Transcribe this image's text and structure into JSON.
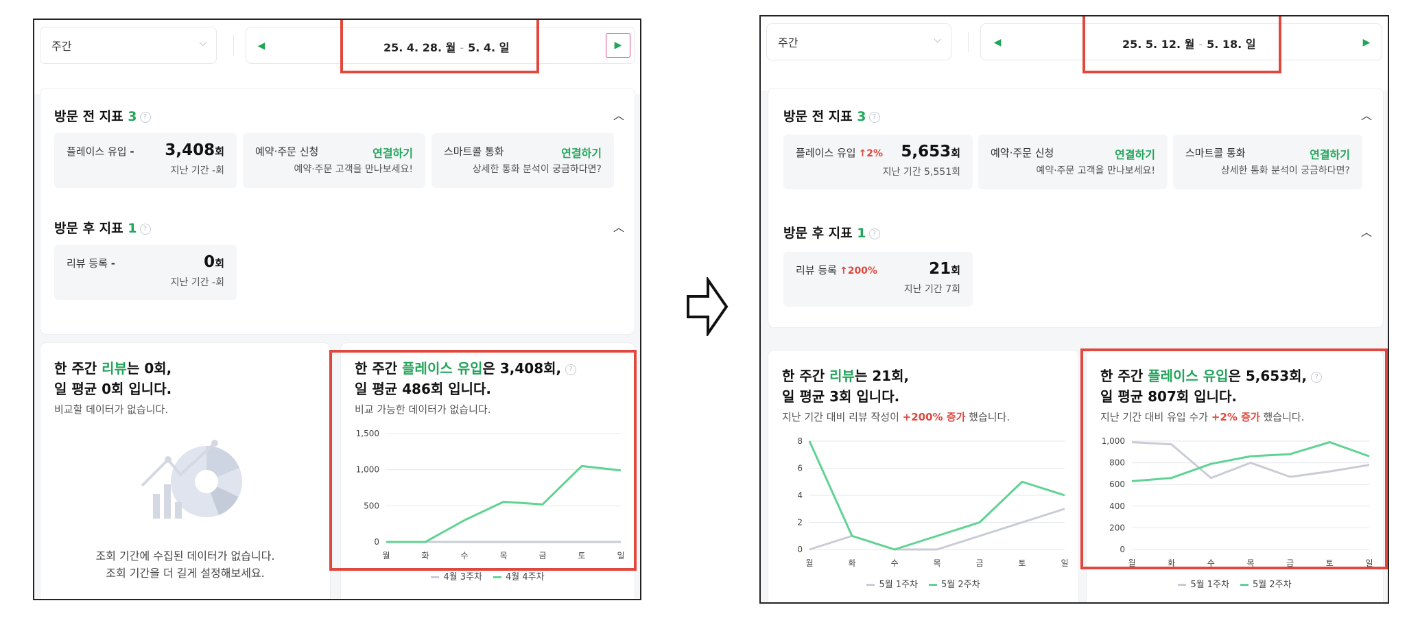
{
  "colors": {
    "accent": "#22a55a",
    "highlight": "#e0483e",
    "prev_line": "#c9ccd6",
    "curr_line": "#5fd392"
  },
  "left": {
    "period": "주간",
    "date_start": "25. 4. 28. 월",
    "date_sep": "-",
    "date_end": "5. 4. 일",
    "pre_visit": {
      "title": "방문 전 지표",
      "count": "3",
      "inflow_label": "플레이스 유입",
      "inflow_trend": "-",
      "inflow_value": "3,408",
      "inflow_unit": "회",
      "inflow_sub": "지난 기간 -회",
      "reserve_label": "예약·주문 신청",
      "reserve_link": "연결하기",
      "reserve_desc": "예약·주문 고객을 만나보세요!",
      "call_label": "스마트콜 통화",
      "call_link": "연결하기",
      "call_desc": "상세한 통화 분석이 궁금하다면?"
    },
    "post_visit": {
      "title": "방문 후 지표",
      "count": "1",
      "review_label": "리뷰 등록",
      "review_trend": "-",
      "review_value": "0",
      "review_unit": "회",
      "review_sub": "지난 기간 -회"
    },
    "review_card": {
      "l1a": "한 주간 ",
      "l1g": "리뷰",
      "l1b": "는 0회,",
      "l2": "일 평균 0회 입니다.",
      "note": "비교할 데이터가 없습니다.",
      "empty1": "조회 기간에 수집된 데이터가 없습니다.",
      "empty2": "조회 기간을 더 길게 설정해보세요."
    },
    "inflow_card": {
      "l1a": "한 주간 ",
      "l1g": "플레이스 유입",
      "l1b": "은 3,408회,",
      "l2": "일 평균 486회 입니다.",
      "note": "비교 가능한 데이터가 없습니다."
    }
  },
  "right": {
    "period": "주간",
    "date_start": "25. 5. 12. 월",
    "date_sep": "-",
    "date_end": "5. 18. 일",
    "pre_visit": {
      "title": "방문 전 지표",
      "count": "3",
      "inflow_label": "플레이스 유입",
      "inflow_trend": "↑2%",
      "inflow_value": "5,653",
      "inflow_unit": "회",
      "inflow_sub": "지난 기간 5,551회",
      "reserve_label": "예약·주문 신청",
      "reserve_link": "연결하기",
      "reserve_desc": "예약·주문 고객을 만나보세요!",
      "call_label": "스마트콜 통화",
      "call_link": "연결하기",
      "call_desc": "상세한 통화 분석이 궁금하다면?"
    },
    "post_visit": {
      "title": "방문 후 지표",
      "count": "1",
      "review_label": "리뷰 등록",
      "review_trend": "↑200%",
      "review_value": "21",
      "review_unit": "회",
      "review_sub": "지난 기간 7회"
    },
    "review_card": {
      "l1a": "한 주간 ",
      "l1g": "리뷰",
      "l1b": "는 21회,",
      "l2": "일 평균 3회 입니다.",
      "note_a": "지난 기간 대비 리뷰 작성이 ",
      "note_r": "+200% 증가",
      "note_b": " 했습니다."
    },
    "inflow_card": {
      "l1a": "한 주간 ",
      "l1g": "플레이스 유입",
      "l1b": "은 5,653회,",
      "l2": "일 평균 807회 입니다.",
      "note_a": "지난 기간 대비 유입 수가 ",
      "note_r": "+2% 증가",
      "note_b": " 했습니다."
    }
  },
  "chart_data": [
    {
      "type": "line",
      "categories": [
        "월",
        "화",
        "수",
        "목",
        "금",
        "토",
        "일"
      ],
      "yticks": [
        "0",
        "500",
        "1,000",
        "1,500"
      ],
      "ylim": [
        0,
        1500
      ],
      "series": [
        {
          "name": "4월 3주차",
          "values": [
            0,
            0,
            0,
            0,
            0,
            0,
            0
          ]
        },
        {
          "name": "4월 4주차",
          "values": [
            0,
            0,
            300,
            555,
            520,
            1050,
            990
          ]
        }
      ]
    },
    {
      "type": "line",
      "categories": [
        "월",
        "화",
        "수",
        "목",
        "금",
        "토",
        "일"
      ],
      "yticks": [
        "0",
        "2",
        "4",
        "6",
        "8"
      ],
      "ylim": [
        0,
        8
      ],
      "series": [
        {
          "name": "5월 1주차",
          "values": [
            0,
            1,
            0,
            0,
            1,
            2,
            3
          ]
        },
        {
          "name": "5월 2주차",
          "values": [
            8,
            1,
            0,
            1,
            2,
            5,
            4
          ]
        }
      ]
    },
    {
      "type": "line",
      "categories": [
        "월",
        "화",
        "수",
        "목",
        "금",
        "토",
        "일"
      ],
      "yticks": [
        "0",
        "200",
        "400",
        "600",
        "800",
        "1,000"
      ],
      "ylim": [
        0,
        1000
      ],
      "series": [
        {
          "name": "5월 1주차",
          "values": [
            990,
            970,
            660,
            800,
            670,
            720,
            780
          ]
        },
        {
          "name": "5월 2주차",
          "values": [
            630,
            660,
            790,
            860,
            880,
            990,
            860
          ]
        }
      ]
    }
  ]
}
